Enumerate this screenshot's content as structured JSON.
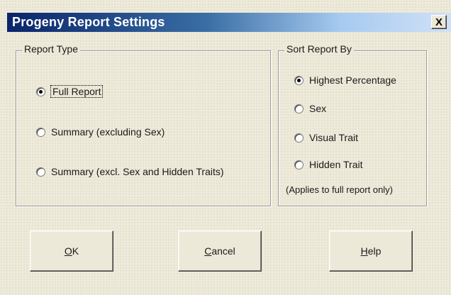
{
  "window": {
    "title": "Progeny Report Settings",
    "close_glyph": "X"
  },
  "report_type": {
    "legend": "Report Type",
    "options": [
      {
        "label": "Full Report",
        "checked": true
      },
      {
        "label": "Summary (excluding Sex)",
        "checked": false
      },
      {
        "label": "Summary (excl. Sex and Hidden Traits)",
        "checked": false
      }
    ]
  },
  "sort_by": {
    "legend": "Sort Report By",
    "options": [
      {
        "label": "Highest Percentage",
        "checked": true
      },
      {
        "label": "Sex",
        "checked": false
      },
      {
        "label": "Visual Trait",
        "checked": false
      },
      {
        "label": "Hidden Trait",
        "checked": false
      }
    ],
    "note": "(Applies to full report only)"
  },
  "buttons": {
    "ok": {
      "mnemonic": "O",
      "rest": "K"
    },
    "cancel": {
      "mnemonic": "C",
      "rest": "ancel"
    },
    "help": {
      "mnemonic": "H",
      "rest": "elp"
    }
  }
}
